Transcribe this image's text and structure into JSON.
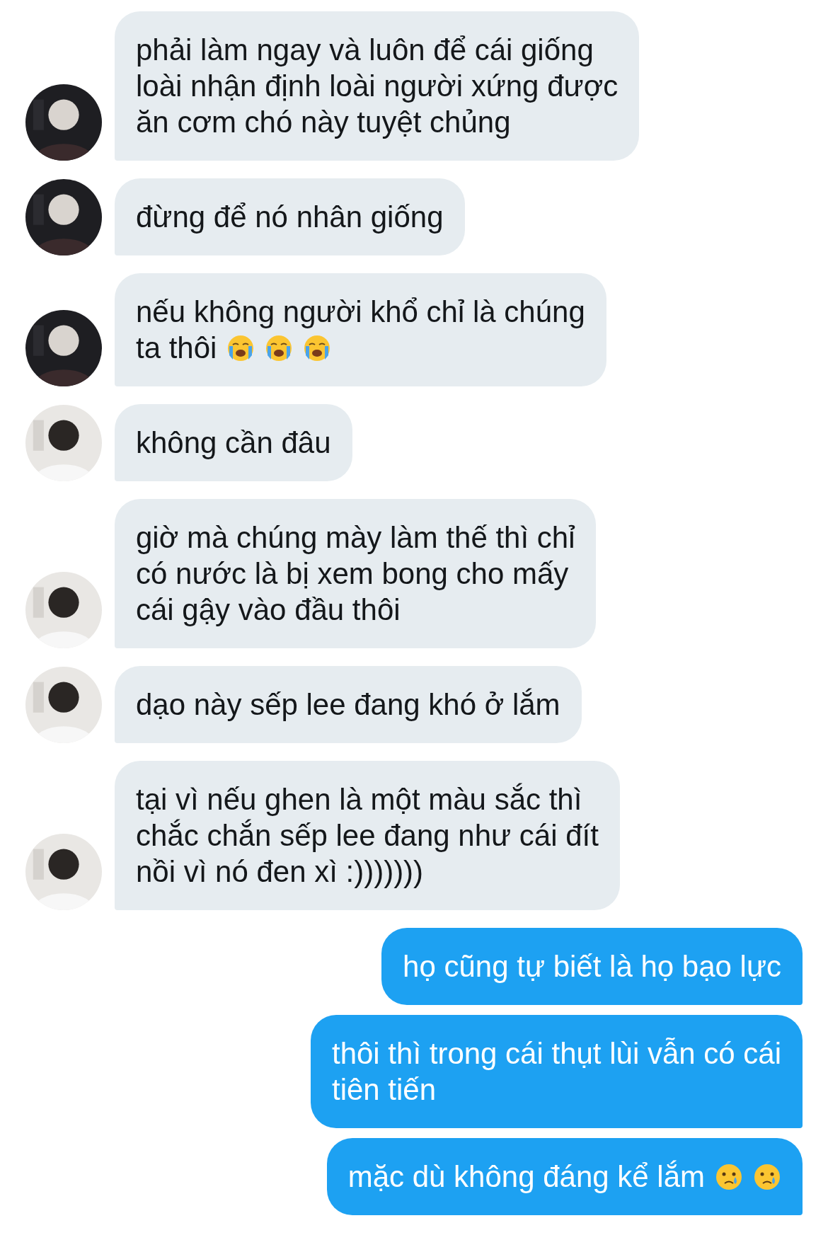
{
  "messages": [
    {
      "kind": "received",
      "avatar": {
        "kind": "picture",
        "color": "#1e1e22"
      },
      "lines": [
        "phải làm ngay và luôn để cái giống",
        "loài nhận định loài người xứng được",
        "ăn cơm chó này tuyệt chủng"
      ]
    },
    {
      "kind": "received",
      "avatar": {
        "kind": "picture",
        "color": "#1e1e22"
      },
      "lines": [
        "đừng để nó nhân giống"
      ]
    },
    {
      "kind": "received",
      "avatar": {
        "kind": "picture",
        "color": "#1e1e22"
      },
      "lines": [
        "nếu không người khổ chỉ là chúng",
        "ta thôi"
      ],
      "emoji": [
        {
          "kind": "crying"
        },
        {
          "kind": "crying"
        },
        {
          "kind": "crying"
        }
      ]
    },
    {
      "kind": "received",
      "avatar": {
        "kind": "picture",
        "color": "#e9e7e4"
      },
      "lines": [
        "không cần đâu"
      ]
    },
    {
      "kind": "received",
      "avatar": {
        "kind": "picture",
        "color": "#e9e7e4"
      },
      "lines": [
        "giờ mà chúng mày làm thế thì chỉ",
        "có nước là bị xem bong cho mấy",
        "cái gậy vào đầu thôi"
      ]
    },
    {
      "kind": "received",
      "avatar": {
        "kind": "picture",
        "color": "#e9e7e4"
      },
      "lines": [
        "dạo này sếp lee đang khó ở lắm"
      ]
    },
    {
      "kind": "received",
      "avatar": {
        "kind": "picture",
        "color": "#e9e7e4"
      },
      "lines": [
        "tại vì nếu ghen là một màu sắc thì",
        "chắc chắn sếp lee đang như cái đít",
        "nồi vì nó đen xì :)))))))"
      ]
    },
    {
      "kind": "sent",
      "lines": [
        "họ cũng tự biết là họ bạo lực"
      ]
    },
    {
      "kind": "sent",
      "lines": [
        "thôi thì trong cái thụt lùi vẫn có cái",
        "tiên tiến"
      ]
    },
    {
      "kind": "sent",
      "lines": [
        "mặc dù không đáng kể lắm"
      ],
      "emoji": [
        {
          "kind": "tearful"
        },
        {
          "kind": "tearful"
        }
      ]
    }
  ]
}
